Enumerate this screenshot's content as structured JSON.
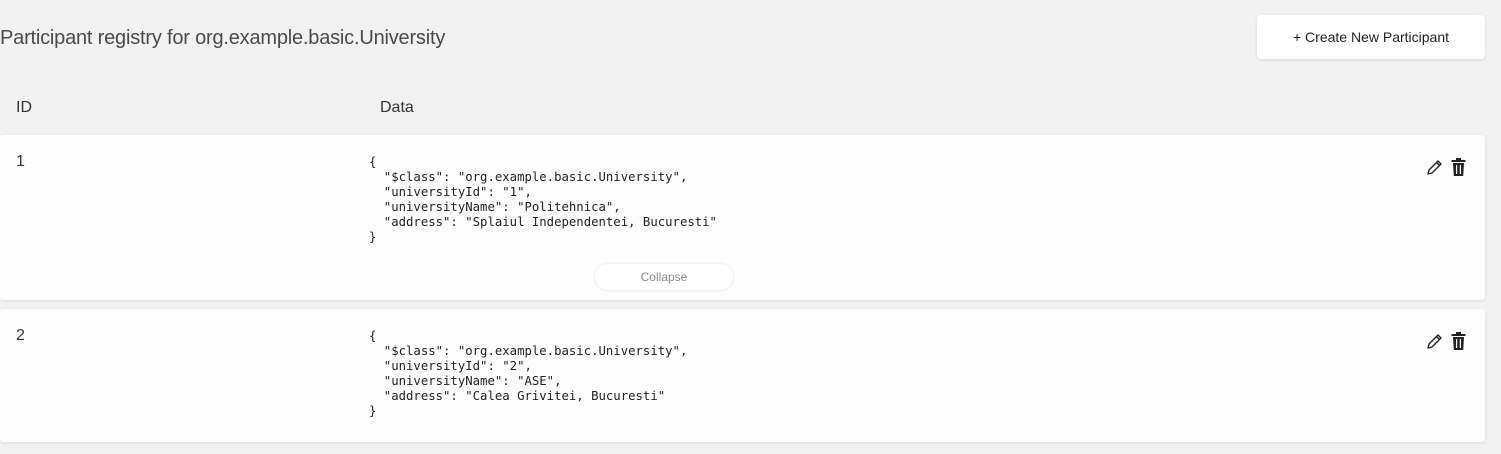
{
  "header": {
    "title": "Participant registry for org.example.basic.University",
    "create_label": "+ Create New Participant"
  },
  "columns": {
    "id": "ID",
    "data": "Data"
  },
  "rows": [
    {
      "id": "1",
      "json": "{\n  \"$class\": \"org.example.basic.University\",\n  \"universityId\": \"1\",\n  \"universityName\": \"Politehnica\",\n  \"address\": \"Splaiul Independentei, Bucuresti\"\n}",
      "collapse_label": "Collapse"
    },
    {
      "id": "2",
      "json": "{\n  \"$class\": \"org.example.basic.University\",\n  \"universityId\": \"2\",\n  \"universityName\": \"ASE\",\n  \"address\": \"Calea Grivitei, Bucuresti\"\n}"
    }
  ],
  "icons": {
    "edit": "pencil-icon",
    "delete": "trash-icon"
  }
}
